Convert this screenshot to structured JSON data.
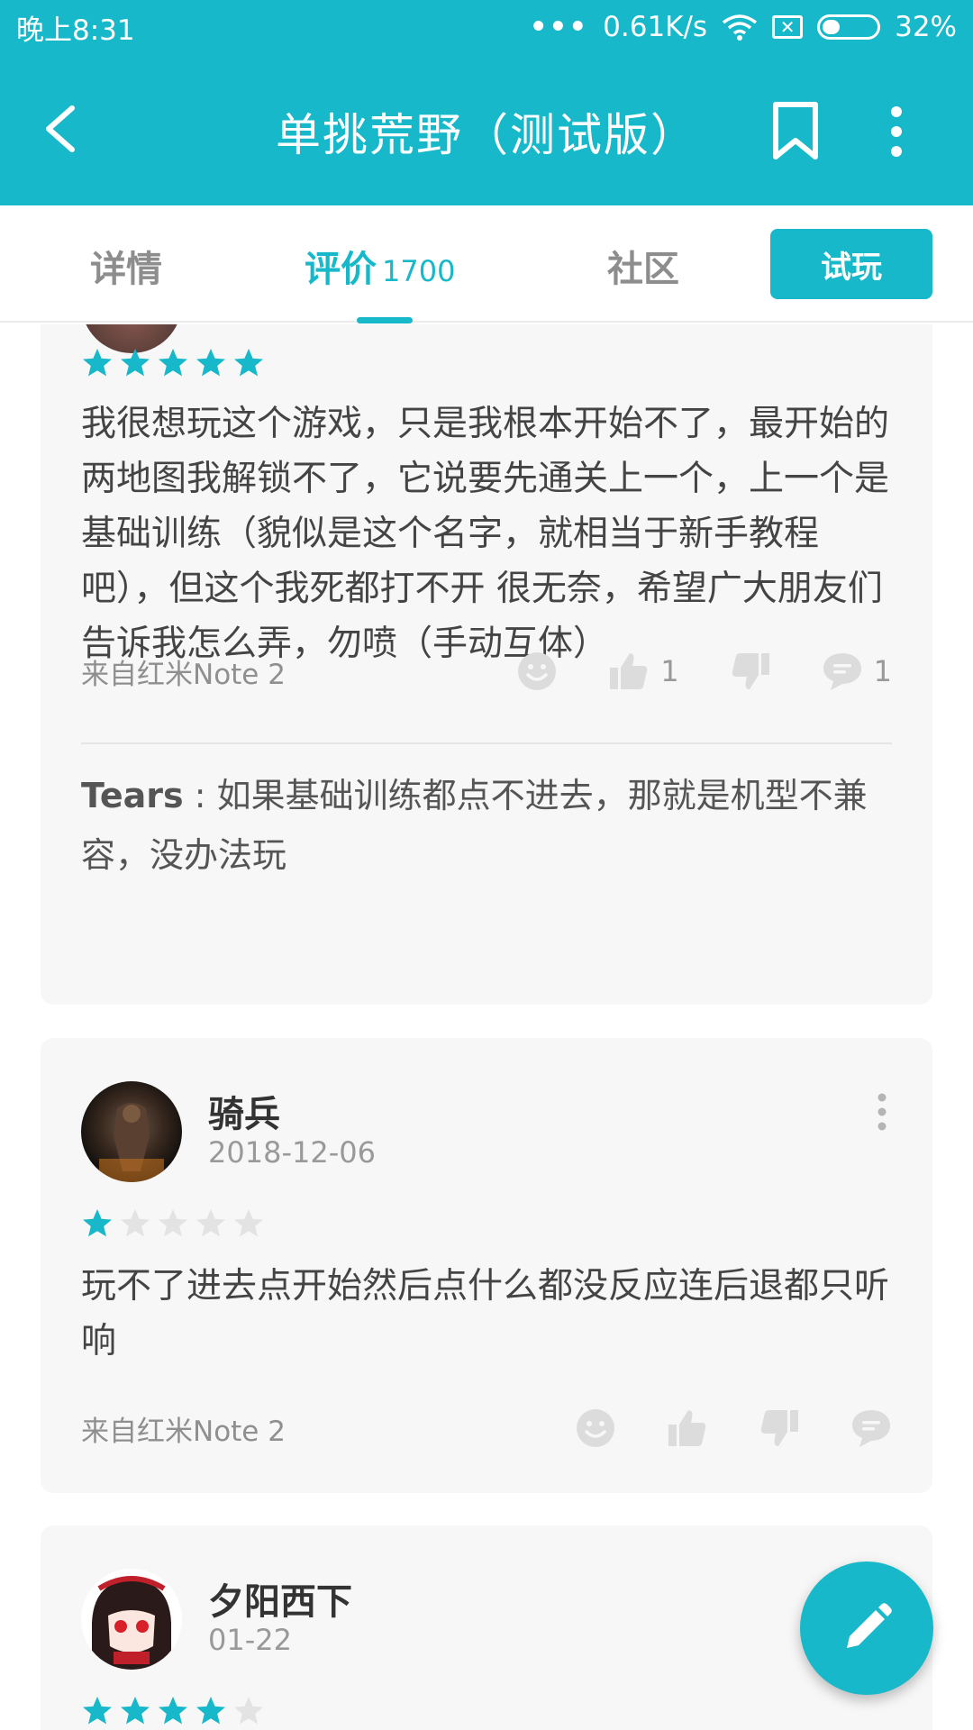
{
  "status_bar": {
    "time": "晚上8:31",
    "dots": "•••",
    "network_speed": "0.61K/s",
    "battery_percent": "32%",
    "battery_level": 0.32
  },
  "app_bar": {
    "title": "单挑荒野（测试版）",
    "back_icon": "chevron-left-icon",
    "bookmark_icon": "bookmark-icon",
    "more_icon": "more-vertical-icon"
  },
  "tabs": {
    "items": [
      {
        "label": "详情",
        "active": false
      },
      {
        "label": "评价",
        "count": "1700",
        "active": true
      },
      {
        "label": "社区",
        "active": false
      }
    ],
    "try_button": "试玩"
  },
  "reviews": [
    {
      "rating": 5,
      "text": "我很想玩这个游戏，只是我根本开始不了，最开始的两地图我解锁不了，它说要先通关上一个，上一个是基础训练（貌似是这个名字，就相当于新手教程吧），但这个我死都打不开 很无奈，希望广大朋友们告诉我怎么弄，勿喷（手动互体）",
      "device": "来自红米Note 2",
      "likes": "1",
      "comments": "1",
      "reply": {
        "author": "Tears",
        "separator": " : ",
        "text": "如果基础训练都点不进去，那就是机型不兼容，没办法玩"
      }
    },
    {
      "username": "骑兵",
      "date": "2018-12-06",
      "rating": 1,
      "text": "玩不了进去点开始然后点什么都没反应连后退都只听响",
      "device": "来自红米Note 2"
    },
    {
      "username": "夕阳西下",
      "date": "01-22",
      "rating": 4
    }
  ],
  "colors": {
    "accent": "#16b8c9",
    "star_empty": "#e3e3e3",
    "card_bg": "#f7f7f7"
  },
  "fab_icon": "pencil-icon"
}
